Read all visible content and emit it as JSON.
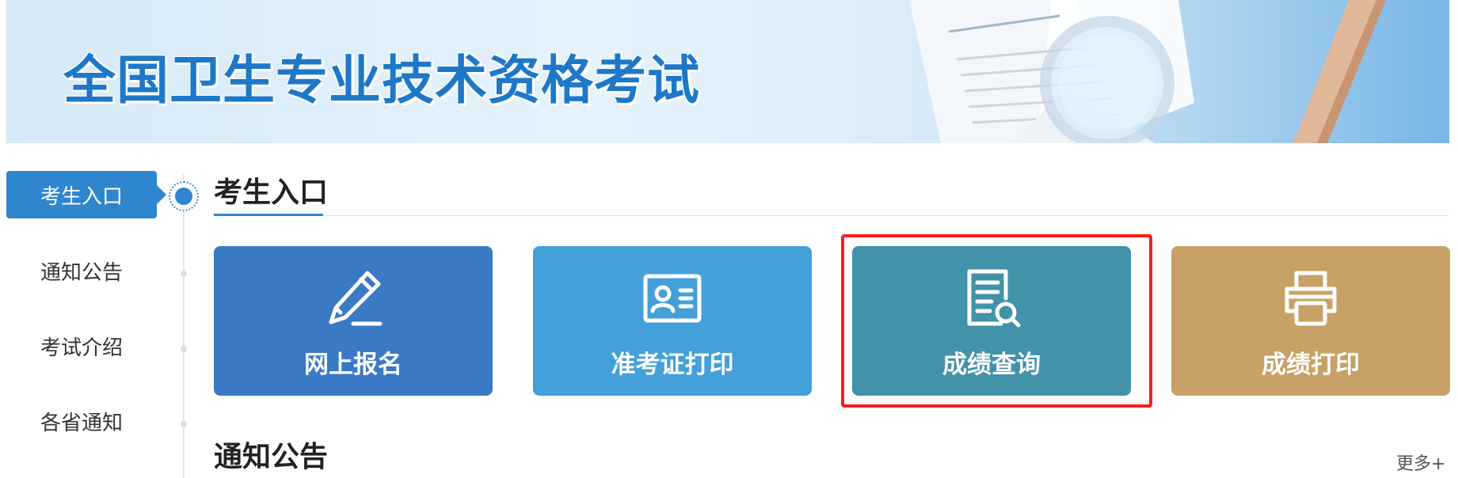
{
  "banner": {
    "title": "全国卫生专业技术资格考试"
  },
  "sidebar": {
    "items": [
      {
        "label": "考生入口",
        "active": true
      },
      {
        "label": "通知公告",
        "active": false
      },
      {
        "label": "考试介绍",
        "active": false
      },
      {
        "label": "各省通知",
        "active": false
      }
    ]
  },
  "main": {
    "section_title": "考生入口",
    "tiles": [
      {
        "label": "网上报名",
        "icon": "pencil-icon",
        "color": "#3a79c4"
      },
      {
        "label": "准考证打印",
        "icon": "id-card-icon",
        "color": "#43a0d8"
      },
      {
        "label": "成绩查询",
        "icon": "document-search-icon",
        "color": "#4292a9",
        "highlighted": true
      },
      {
        "label": "成绩打印",
        "icon": "printer-icon",
        "color": "#c7a165"
      }
    ],
    "notice_title": "通知公告",
    "more_label": "更多+"
  },
  "colors": {
    "accent": "#2f86cf",
    "highlight": "#ff1a1a"
  }
}
